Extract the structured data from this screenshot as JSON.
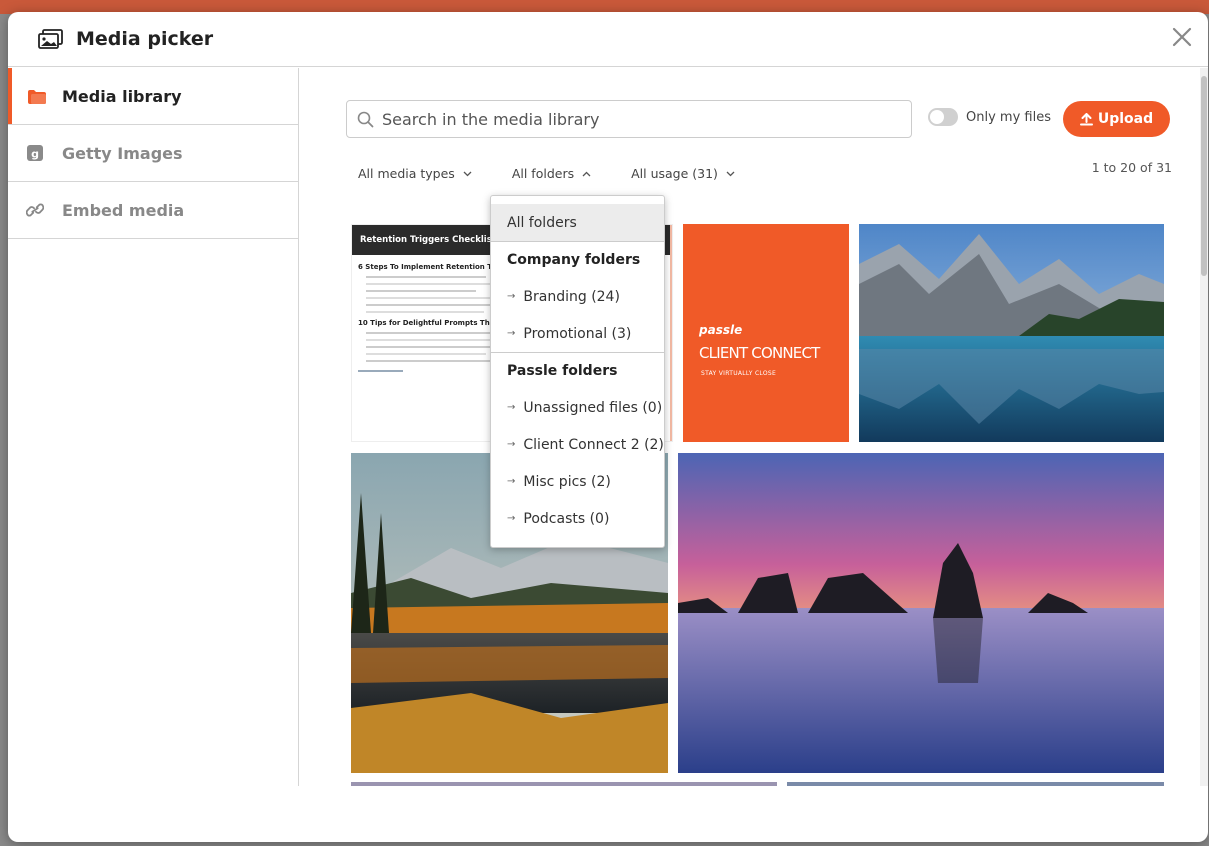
{
  "modal": {
    "title": "Media picker",
    "close_icon": "close-icon"
  },
  "sidebar": {
    "items": [
      {
        "label": "Media library",
        "icon": "folder-icon",
        "active": true
      },
      {
        "label": "Getty Images",
        "icon": "getty-icon",
        "active": false
      },
      {
        "label": "Embed media",
        "icon": "link-icon",
        "active": false
      }
    ]
  },
  "toolbar": {
    "search_placeholder": "Search in the media library",
    "only_my_files_label": "Only my files",
    "only_my_files_on": false,
    "upload_label": "Upload"
  },
  "filters": {
    "media_types": "All media types",
    "folders": "All folders",
    "usage": "All usage (31)"
  },
  "pager": "1 to 20 of 31",
  "folder_dropdown": {
    "all": "All folders",
    "company_heading": "Company folders",
    "company": [
      "Branding (24)",
      "Promotional (3)"
    ],
    "passle_heading": "Passle folders",
    "passle": [
      "Unassigned files (0)",
      "Client Connect 2 (2)",
      "Misc pics (2)",
      "Podcasts (0)"
    ]
  },
  "tiles": {
    "checklist_title": "Retention Triggers Checklist",
    "checklist_section1": "6 Steps To Implement Retention Triggers",
    "checklist_section2": "10 Tips for Delightful Prompts That Convert",
    "cc_brand": "passle",
    "cc_title": "CLIENT CONNECT",
    "cc_tagline": "STAY VIRTUALLY CLOSE"
  },
  "colors": {
    "accent": "#f05a28"
  }
}
